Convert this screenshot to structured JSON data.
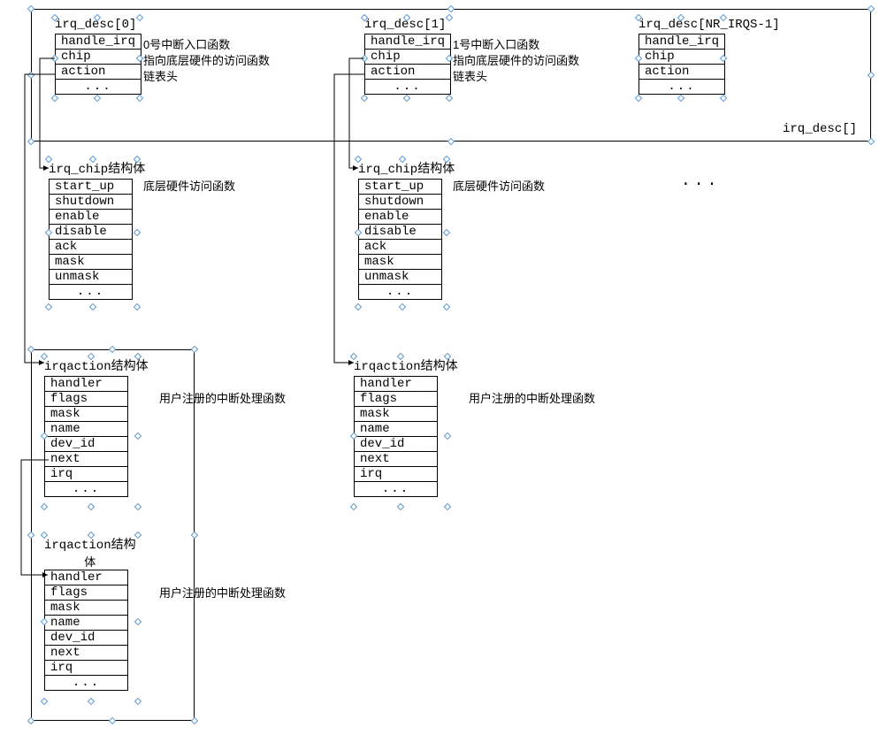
{
  "array_label": "irq_desc[]",
  "ellipsis": "...",
  "irq_desc": [
    {
      "title": "irq_desc[0]",
      "rows": [
        "handle_irq",
        "chip",
        "action",
        "..."
      ],
      "annots": [
        "0号中断入口函数",
        "指向底层硬件的访问函数",
        "链表头"
      ]
    },
    {
      "title": "irq_desc[1]",
      "rows": [
        "handle_irq",
        "chip",
        "action",
        "..."
      ],
      "annots": [
        "1号中断入口函数",
        "指向底层硬件的访问函数",
        "链表头"
      ]
    },
    {
      "title": "irq_desc[NR_IRQS-1]",
      "rows": [
        "handle_irq",
        "chip",
        "action",
        "..."
      ]
    }
  ],
  "irq_chip": {
    "title_prefix": "irq_chip",
    "title_suffix": "结构体",
    "rows": [
      "start_up",
      "shutdown",
      "enable",
      "disable",
      "ack",
      "mask",
      "unmask",
      "..."
    ],
    "annot": "底层硬件访问函数"
  },
  "irqaction": {
    "title_prefix": "irqaction",
    "title_suffix": "结构体",
    "title_suffix_short": "结构",
    "title_body_char": "体",
    "rows": [
      "handler",
      "flags",
      "mask",
      "name",
      "dev_id",
      "next",
      "irq",
      "..."
    ],
    "annot": "用户注册的中断处理函数"
  }
}
